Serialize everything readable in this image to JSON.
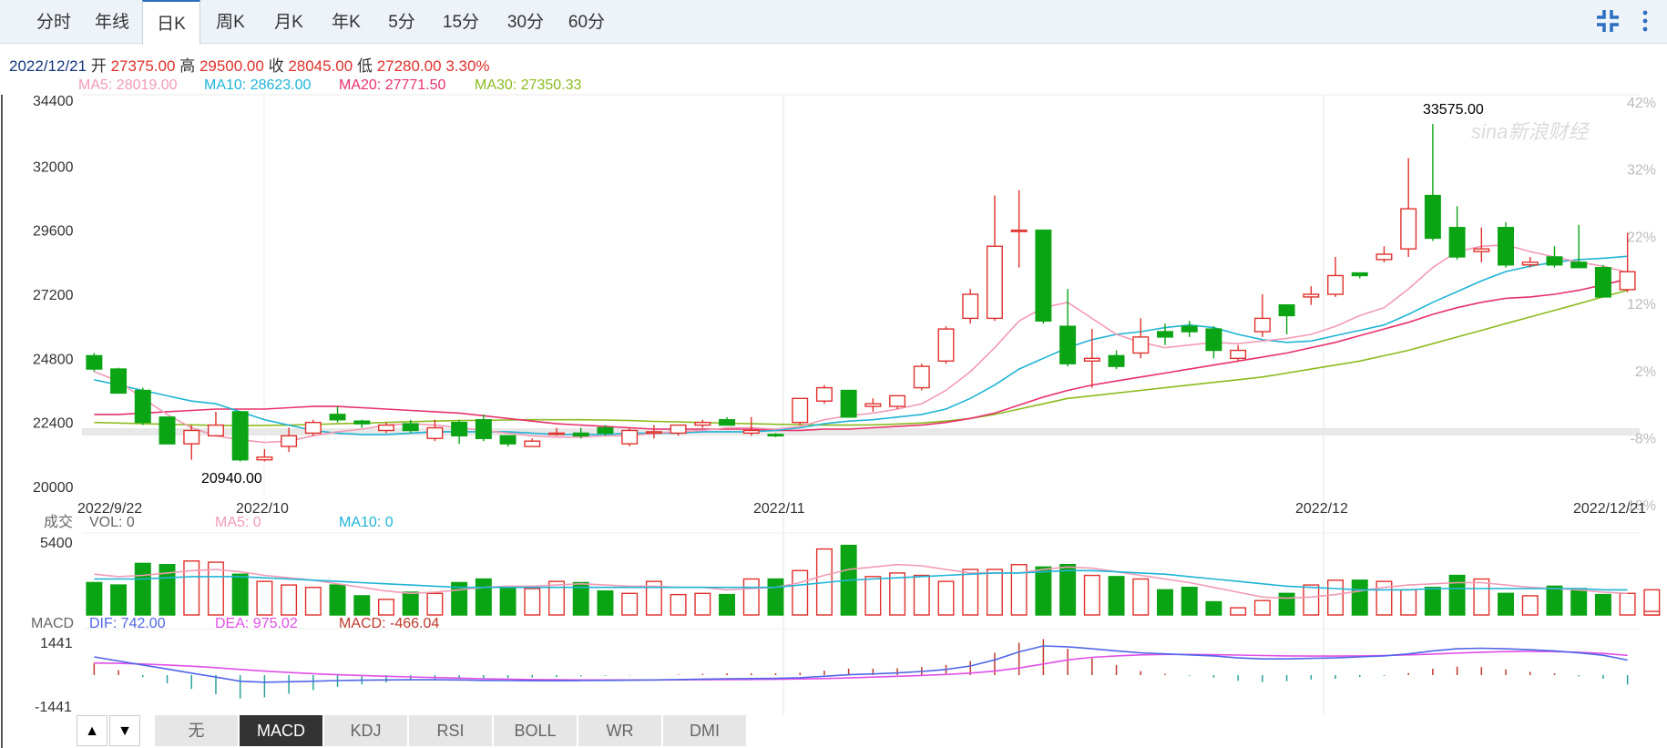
{
  "tabs": [
    {
      "label": "分时",
      "active": false
    },
    {
      "label": "年线",
      "active": false
    },
    {
      "label": "日K",
      "active": true
    },
    {
      "label": "周K",
      "active": false
    },
    {
      "label": "月K",
      "active": false
    },
    {
      "label": "年K",
      "active": false
    },
    {
      "label": "5分",
      "active": false
    },
    {
      "label": "15分",
      "active": false
    },
    {
      "label": "30分",
      "active": false
    },
    {
      "label": "60分",
      "active": false
    }
  ],
  "quote": {
    "date": "2022/12/21",
    "open_label": "开",
    "open": "27375.00",
    "high_label": "高",
    "high": "29500.00",
    "close_label": "收",
    "close": "28045.00",
    "low_label": "低",
    "low": "27280.00",
    "change": "3.30%"
  },
  "ma_legend": [
    {
      "label": "MA5: 28019.00",
      "color": "#f29bb5"
    },
    {
      "label": "MA10: 28623.00",
      "color": "#1eb4d6"
    },
    {
      "label": "MA20: 27771.50",
      "color": "#e8316b"
    },
    {
      "label": "MA30: 27350.33",
      "color": "#8bbb1e"
    }
  ],
  "watermark": "sina新浪财经",
  "colors": {
    "up": "#e0312c",
    "down": "#0aa414",
    "ma5": "#f29bb5",
    "ma10": "#1eb4d6",
    "ma20": "#e8316b",
    "ma30": "#8bbb1e",
    "dif": "#5066e8",
    "dea": "#e04fe8"
  },
  "chart_data": {
    "type": "candlestick",
    "price_axis": {
      "ticks": [
        "34400",
        "32000",
        "29600",
        "27200",
        "24800",
        "22400",
        "20000"
      ],
      "min": 20000,
      "max": 34400
    },
    "pct_axis": {
      "ticks": [
        "42%",
        "32%",
        "22%",
        "12%",
        "2%",
        "-8%",
        "-18%"
      ]
    },
    "date_labels": [
      "2022/9/22",
      "2022/10",
      "2022/11",
      "2022/12",
      "2022/12/21"
    ],
    "max_label": "33575.00",
    "min_label": "20940.00",
    "candles": [
      [
        24900,
        25000,
        24300,
        24400
      ],
      [
        24400,
        24450,
        23500,
        23500
      ],
      [
        23600,
        23700,
        22300,
        22400
      ],
      [
        22600,
        22600,
        21600,
        21600
      ],
      [
        21600,
        22300,
        21000,
        22100
      ],
      [
        21900,
        22800,
        21900,
        22300
      ],
      [
        22800,
        22800,
        20940,
        21000
      ],
      [
        21000,
        21400,
        20940,
        21100
      ],
      [
        21500,
        22200,
        21300,
        21900
      ],
      [
        22000,
        22500,
        21900,
        22400
      ],
      [
        22700,
        23000,
        22400,
        22500
      ],
      [
        22450,
        22500,
        22200,
        22350
      ],
      [
        22100,
        22400,
        22000,
        22300
      ],
      [
        22350,
        22500,
        22000,
        22100
      ],
      [
        21800,
        22500,
        21700,
        22200
      ],
      [
        22400,
        22500,
        21600,
        21900
      ],
      [
        22500,
        22700,
        21700,
        21800
      ],
      [
        21900,
        21900,
        21500,
        21600
      ],
      [
        21500,
        21800,
        21500,
        21700
      ],
      [
        22000,
        22200,
        21900,
        22000
      ],
      [
        22000,
        22200,
        21800,
        21900
      ],
      [
        22200,
        22300,
        21900,
        22000
      ],
      [
        21600,
        22200,
        21500,
        22100
      ],
      [
        22000,
        22300,
        21800,
        22050
      ],
      [
        22000,
        22300,
        21900,
        22300
      ],
      [
        22300,
        22500,
        22200,
        22400
      ],
      [
        22500,
        22600,
        22300,
        22300
      ],
      [
        22000,
        22600,
        21900,
        22100
      ],
      [
        21950,
        22000,
        21850,
        21900
      ],
      [
        22400,
        23300,
        22300,
        23300
      ],
      [
        23200,
        23800,
        23100,
        23700
      ],
      [
        23600,
        23600,
        22600,
        22600
      ],
      [
        23000,
        23300,
        22800,
        23100
      ],
      [
        23000,
        23400,
        22900,
        23400
      ],
      [
        23700,
        24600,
        23600,
        24500
      ],
      [
        24700,
        26000,
        24600,
        25900
      ],
      [
        26300,
        27400,
        26100,
        27200
      ],
      [
        26300,
        30900,
        26200,
        29000
      ],
      [
        29600,
        31100,
        28200,
        29600
      ],
      [
        29600,
        29600,
        26100,
        26200
      ],
      [
        26000,
        27400,
        24500,
        24600
      ],
      [
        24700,
        25900,
        23700,
        24800
      ],
      [
        24900,
        25100,
        24400,
        24500
      ],
      [
        25000,
        26300,
        24800,
        25600
      ],
      [
        25800,
        26100,
        25300,
        25600
      ],
      [
        26000,
        26200,
        25600,
        25800
      ],
      [
        25900,
        26000,
        24800,
        25100
      ],
      [
        24800,
        25300,
        24700,
        25100
      ],
      [
        25800,
        27200,
        25600,
        26300
      ],
      [
        26800,
        26800,
        25700,
        26400
      ],
      [
        27100,
        27500,
        26800,
        27200
      ],
      [
        27200,
        28600,
        27100,
        27900
      ],
      [
        28000,
        28000,
        27800,
        27900
      ],
      [
        28500,
        29000,
        28400,
        28700
      ],
      [
        28900,
        32300,
        28600,
        30400
      ],
      [
        30900,
        33575,
        29200,
        29300
      ],
      [
        29700,
        30500,
        28500,
        28600
      ],
      [
        28800,
        29700,
        28400,
        28900
      ],
      [
        29700,
        29900,
        28200,
        28300
      ],
      [
        28300,
        28600,
        28200,
        28400
      ],
      [
        28600,
        29000,
        28200,
        28300
      ],
      [
        28400,
        29800,
        28200,
        28200
      ],
      [
        28200,
        28300,
        27100,
        27100
      ],
      [
        27375,
        29500,
        27280,
        28045
      ]
    ],
    "ma5": [
      24300,
      23950,
      23300,
      22700,
      22200,
      21900,
      21750,
      21650,
      21700,
      21900,
      22050,
      22150,
      22300,
      22350,
      22300,
      22200,
      22100,
      22000,
      21900,
      21850,
      21850,
      21900,
      21900,
      22000,
      22050,
      22100,
      22200,
      22200,
      22150,
      22250,
      22500,
      22650,
      22750,
      22900,
      23100,
      23600,
      24300,
      25200,
      26200,
      26700,
      26900,
      26300,
      25700,
      25400,
      25200,
      25300,
      25400,
      25350,
      25450,
      25550,
      25700,
      26000,
      26400,
      26700,
      27400,
      28200,
      28800,
      29000,
      29050,
      28800,
      28600,
      28400,
      28250,
      28019
    ],
    "ma10": [
      24000,
      23800,
      23600,
      23400,
      23200,
      23100,
      22800,
      22500,
      22300,
      22100,
      22000,
      21950,
      21950,
      22000,
      22050,
      22050,
      22050,
      22050,
      22000,
      21950,
      21950,
      21950,
      22000,
      22000,
      22000,
      22050,
      22050,
      22050,
      22100,
      22200,
      22350,
      22450,
      22500,
      22600,
      22700,
      22900,
      23300,
      23800,
      24400,
      24800,
      25200,
      25500,
      25700,
      25800,
      25950,
      26050,
      25950,
      25700,
      25500,
      25400,
      25450,
      25650,
      25850,
      26050,
      26450,
      26900,
      27300,
      27700,
      28050,
      28250,
      28400,
      28500,
      28550,
      28623
    ],
    "ma20": [
      22700,
      22700,
      22750,
      22800,
      22850,
      22900,
      22900,
      22900,
      22950,
      23000,
      23000,
      22950,
      22900,
      22850,
      22800,
      22750,
      22650,
      22550,
      22450,
      22350,
      22300,
      22250,
      22200,
      22150,
      22150,
      22150,
      22150,
      22150,
      22100,
      22100,
      22150,
      22150,
      22200,
      22250,
      22300,
      22400,
      22550,
      22750,
      23050,
      23350,
      23600,
      23800,
      23950,
      24100,
      24250,
      24400,
      24550,
      24700,
      24850,
      25000,
      25200,
      25400,
      25650,
      25900,
      26150,
      26450,
      26700,
      26900,
      27050,
      27100,
      27200,
      27350,
      27550,
      27771
    ],
    "ma30": [
      22400,
      22380,
      22350,
      22330,
      22310,
      22290,
      22280,
      22290,
      22300,
      22320,
      22350,
      22370,
      22400,
      22430,
      22450,
      22470,
      22480,
      22490,
      22500,
      22500,
      22500,
      22490,
      22470,
      22440,
      22420,
      22400,
      22370,
      22350,
      22330,
      22320,
      22300,
      22300,
      22310,
      22340,
      22380,
      22450,
      22550,
      22700,
      22900,
      23100,
      23300,
      23400,
      23500,
      23600,
      23700,
      23800,
      23900,
      24000,
      24100,
      24250,
      24400,
      24550,
      24700,
      24900,
      25100,
      25350,
      25600,
      25850,
      26100,
      26350,
      26600,
      26850,
      27100,
      27350
    ],
    "volume": {
      "label": "成交",
      "vol_label": "VOL: 0",
      "ma5_label": "MA5: 0",
      "ma10_label": "MA10: 0",
      "axis_max": "5400",
      "values": [
        2700,
        2500,
        4300,
        4200,
        4500,
        4400,
        3400,
        2800,
        2500,
        2300,
        2500,
        1600,
        1300,
        1900,
        1800,
        2700,
        3000,
        2200,
        2200,
        2800,
        2700,
        2000,
        1800,
        2800,
        1700,
        1800,
        1700,
        3000,
        3000,
        3700,
        5500,
        5800,
        3200,
        3500,
        3300,
        2800,
        3800,
        3800,
        4200,
        4000,
        4200,
        3300,
        3200,
        3000,
        2100,
        2300,
        1100,
        600,
        1200,
        1800,
        2500,
        2900,
        2900,
        2800,
        2100,
        2300,
        3300,
        3000,
        1800,
        1600,
        2400,
        2200,
        1700,
        1800,
        2100,
        300
      ],
      "ma5": [
        3400,
        3200,
        3300,
        3500,
        3700,
        3800,
        3600,
        3300,
        3100,
        2900,
        2600,
        2300,
        2000,
        1800,
        1900,
        2100,
        2300,
        2400,
        2400,
        2500,
        2600,
        2500,
        2400,
        2400,
        2300,
        2300,
        2100,
        2200,
        2300,
        2700,
        3300,
        3800,
        4000,
        4200,
        4100,
        3800,
        3500,
        3500,
        3500,
        3800,
        4000,
        3900,
        3600,
        3300,
        3000,
        2700,
        2300,
        1900,
        1500,
        1400,
        1500,
        1700,
        2000,
        2300,
        2500,
        2600,
        2700,
        2700,
        2500,
        2300,
        2200,
        2100,
        1900,
        1800
      ],
      "ma10": [
        3000,
        3000,
        3000,
        3100,
        3200,
        3200,
        3200,
        3100,
        3000,
        2900,
        2800,
        2700,
        2600,
        2500,
        2400,
        2300,
        2300,
        2300,
        2300,
        2300,
        2300,
        2300,
        2300,
        2300,
        2300,
        2300,
        2300,
        2300,
        2300,
        2500,
        2700,
        2900,
        3000,
        3100,
        3200,
        3300,
        3400,
        3500,
        3500,
        3600,
        3700,
        3700,
        3600,
        3500,
        3400,
        3200,
        3000,
        2800,
        2600,
        2400,
        2300,
        2200,
        2100,
        2100,
        2100,
        2200,
        2200,
        2200,
        2200,
        2200,
        2200,
        2200,
        2100,
        2100
      ]
    },
    "macd": {
      "label": "MACD",
      "dif_label": "DIF: 742.00",
      "dea_label": "DEA: 975.02",
      "macd_label": "MACD: -466.04",
      "axis_top": "1441",
      "axis_bottom": "-1441",
      "dif": [
        900,
        700,
        500,
        300,
        100,
        -100,
        -300,
        -350,
        -330,
        -300,
        -270,
        -250,
        -240,
        -230,
        -230,
        -240,
        -260,
        -270,
        -280,
        -280,
        -270,
        -260,
        -250,
        -240,
        -220,
        -200,
        -180,
        -170,
        -160,
        -130,
        -60,
        20,
        60,
        110,
        180,
        280,
        450,
        750,
        1150,
        1441,
        1400,
        1300,
        1200,
        1100,
        1050,
        1000,
        950,
        850,
        800,
        800,
        830,
        850,
        900,
        950,
        1050,
        1200,
        1300,
        1330,
        1300,
        1250,
        1200,
        1100,
        980,
        742
      ],
      "dea": [
        600,
        580,
        550,
        500,
        440,
        370,
        280,
        200,
        130,
        70,
        20,
        -20,
        -60,
        -90,
        -120,
        -150,
        -180,
        -200,
        -220,
        -230,
        -240,
        -240,
        -240,
        -240,
        -235,
        -230,
        -225,
        -215,
        -205,
        -190,
        -170,
        -140,
        -100,
        -60,
        -20,
        30,
        100,
        200,
        350,
        550,
        750,
        880,
        950,
        1000,
        1020,
        1020,
        1010,
        990,
        970,
        950,
        940,
        940,
        950,
        970,
        1000,
        1040,
        1090,
        1130,
        1160,
        1170,
        1160,
        1130,
        1070,
        975
      ]
    }
  },
  "lower_tabs": {
    "up_arrow": "▲",
    "down_arrow": "▼",
    "items": [
      {
        "label": "无",
        "active": false
      },
      {
        "label": "MACD",
        "active": true
      },
      {
        "label": "KDJ",
        "active": false
      },
      {
        "label": "RSI",
        "active": false
      },
      {
        "label": "BOLL",
        "active": false
      },
      {
        "label": "WR",
        "active": false
      },
      {
        "label": "DMI",
        "active": false
      }
    ]
  }
}
